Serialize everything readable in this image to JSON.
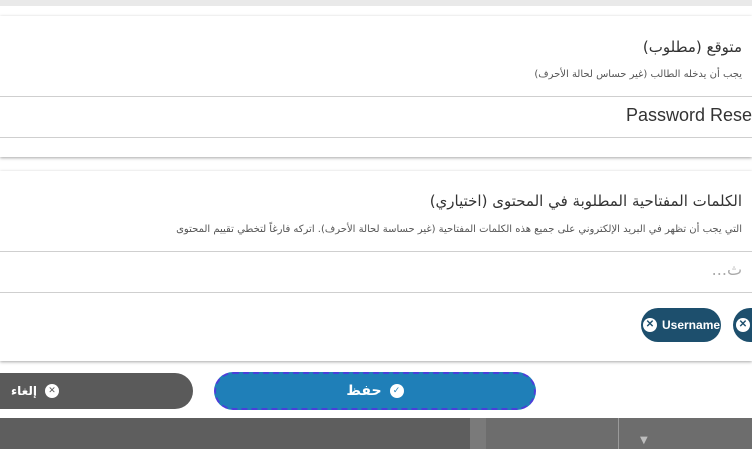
{
  "card1": {
    "title": "متوقع (مطلوب)",
    "help": "يجب أن يدخله الطالب (غير حساس لحالة الأحرف)",
    "value": "Password Rese"
  },
  "card2": {
    "title": "الكلمات المفتاحية المطلوبة في المحتوى (اختياري)",
    "help": "التي يجب أن تظهر في البريد الإلكتروني على جميع هذه الكلمات المفتاحية (غير حساسة لحالة الأحرف). اتركه فارغاً لتخطي تقييم المحتوى",
    "placeholder": "...ث",
    "chips": [
      {
        "label": "Username"
      }
    ]
  },
  "actions": {
    "save_label": "حفظ",
    "cancel_label": "إلغاء"
  },
  "colors": {
    "accent": "#1f7fb8",
    "chip": "#1d4f6d",
    "cancel": "#5a5a5a"
  }
}
